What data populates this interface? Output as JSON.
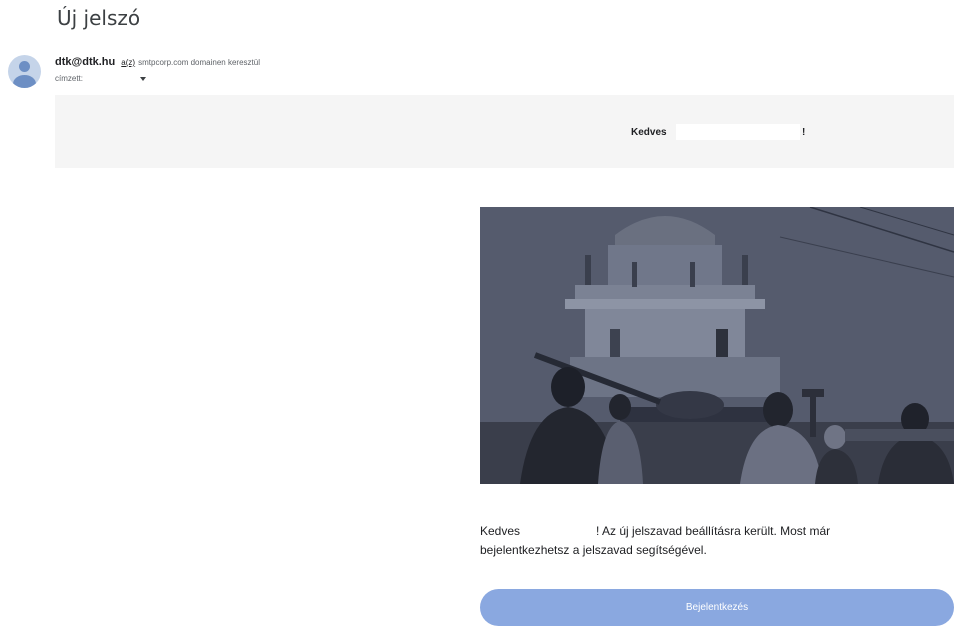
{
  "email": {
    "subject": "Új jelszó",
    "sender": "dtk@dtk.hu",
    "via_prefix": "a(z)",
    "via_suffix": "smtpcorp.com domainen keresztül",
    "to_label": "címzett:",
    "greeting_word": "Kedves",
    "greeting_end": "!",
    "hero_image": "grayscale photo of tank and crowd in front of a monument",
    "body_start": "Kedves",
    "body_rest": "! Az új jelszavad beállításra került. Most már bejelentkezhetsz a jelszavad segítségével.",
    "button_label": "Bejelentkezés",
    "button_color": "#8aa8e0"
  }
}
